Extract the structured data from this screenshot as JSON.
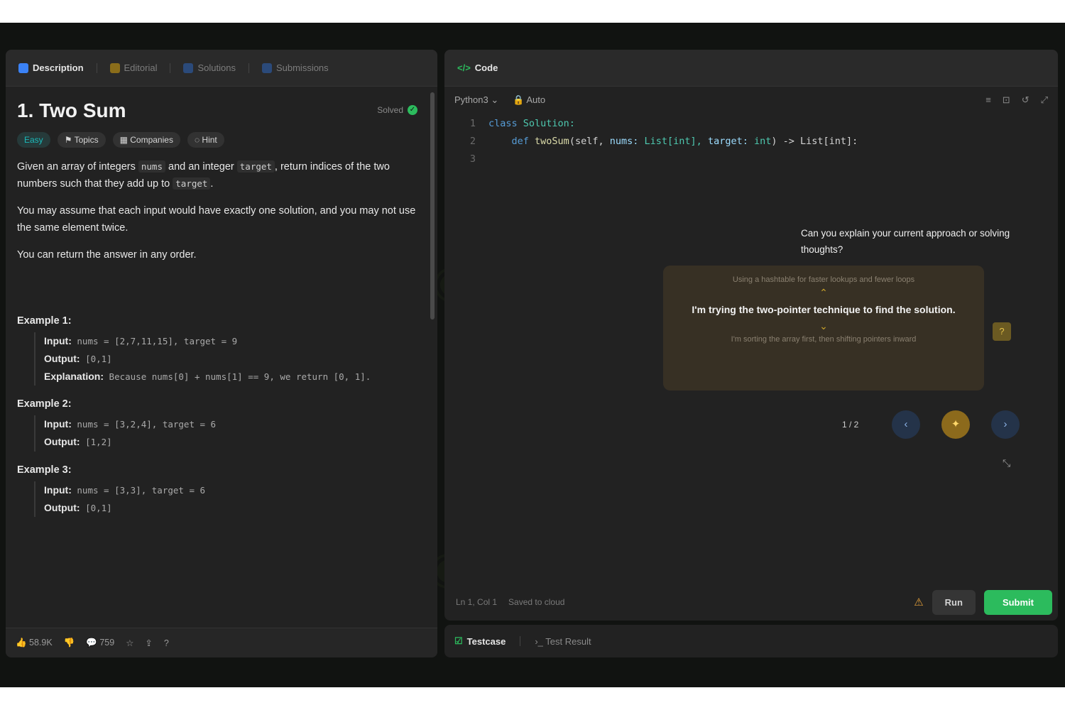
{
  "left_tabs": [
    {
      "label": "Description",
      "color": "#3b82f6"
    },
    {
      "label": "Editorial",
      "color": "#eab308"
    },
    {
      "label": "Solutions",
      "color": "#3b82f6"
    },
    {
      "label": "Submissions",
      "color": "#3b82f6"
    }
  ],
  "problem": {
    "title": "1. Two Sum",
    "solved_label": "Solved",
    "difficulty": "Easy",
    "chips": [
      "Topics",
      "Companies",
      "Hint"
    ],
    "desc_p1_pre": "Given an array of integers",
    "desc_p1_code1": "nums",
    "desc_p1_mid": "and an integer",
    "desc_p1_code2": "target",
    "desc_p1_post": ", return indices of the two numbers such that they add up to",
    "desc_p1_code3": "target",
    "desc_p2": "You may assume that each input would have exactly one solution, and you may not use the same element twice.",
    "desc_p3": "You can return the answer in any order.",
    "examples": [
      {
        "heading": "Example 1:",
        "input_label": "Input:",
        "input": "nums = [2,7,11,15], target = 9",
        "output_label": "Output:",
        "output": "[0,1]",
        "expl_label": "Explanation:",
        "explanation": "Because nums[0] + nums[1] == 9, we return [0, 1]."
      },
      {
        "heading": "Example 2:",
        "input_label": "Input:",
        "input": "nums = [3,2,4], target = 6",
        "output_label": "Output:",
        "output": "[1,2]"
      },
      {
        "heading": "Example 3:",
        "input_label": "Input:",
        "input": "nums = [3,3], target = 6",
        "output_label": "Output:",
        "output": "[0,1]"
      }
    ]
  },
  "left_footer": {
    "likes": "58.9K",
    "comments": "759"
  },
  "editor": {
    "tab_label": "Code",
    "language": "Python3",
    "auto_label": "Auto",
    "line_numbers": [
      "1",
      "2",
      "3"
    ],
    "code_l1": {
      "kw": "class",
      "cls": "Solution:"
    },
    "code_l2": {
      "kw": "def",
      "fn": "twoSum",
      "p1": "(self,",
      "a1": "nums:",
      "t1": "List[int],",
      "a2": "target:",
      "t2": "int",
      "arrow": ") -> List[int]:"
    },
    "status": "Ln 1, Col 1",
    "saved": "Saved to cloud",
    "run_label": "Run",
    "submit_label": "Submit"
  },
  "hint": {
    "question": "Can you explain your current approach or solving thoughts?",
    "previous": "Using a hashtable for faster lookups and fewer loops",
    "current": "I'm trying the two-pointer technique to find the solution.",
    "next": "I'm sorting the array first, then shifting pointers inward",
    "counter": "1 / 2",
    "badge": "?"
  },
  "test_tabs": {
    "testcase": "Testcase",
    "result": "Test Result"
  },
  "colors": {
    "accent_green": "#2cbb5d",
    "hint_gold": "#c9a22a",
    "easy_teal": "#1cbaba"
  }
}
